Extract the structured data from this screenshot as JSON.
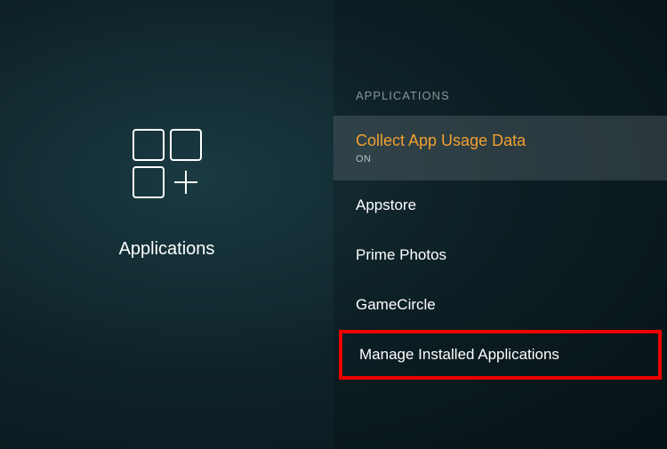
{
  "leftPanel": {
    "label": "Applications"
  },
  "rightPanel": {
    "sectionHeader": "APPLICATIONS",
    "items": [
      {
        "title": "Collect App Usage Data",
        "subtitle": "ON"
      },
      {
        "title": "Appstore"
      },
      {
        "title": "Prime Photos"
      },
      {
        "title": "GameCircle"
      },
      {
        "title": "Manage Installed Applications"
      }
    ]
  }
}
